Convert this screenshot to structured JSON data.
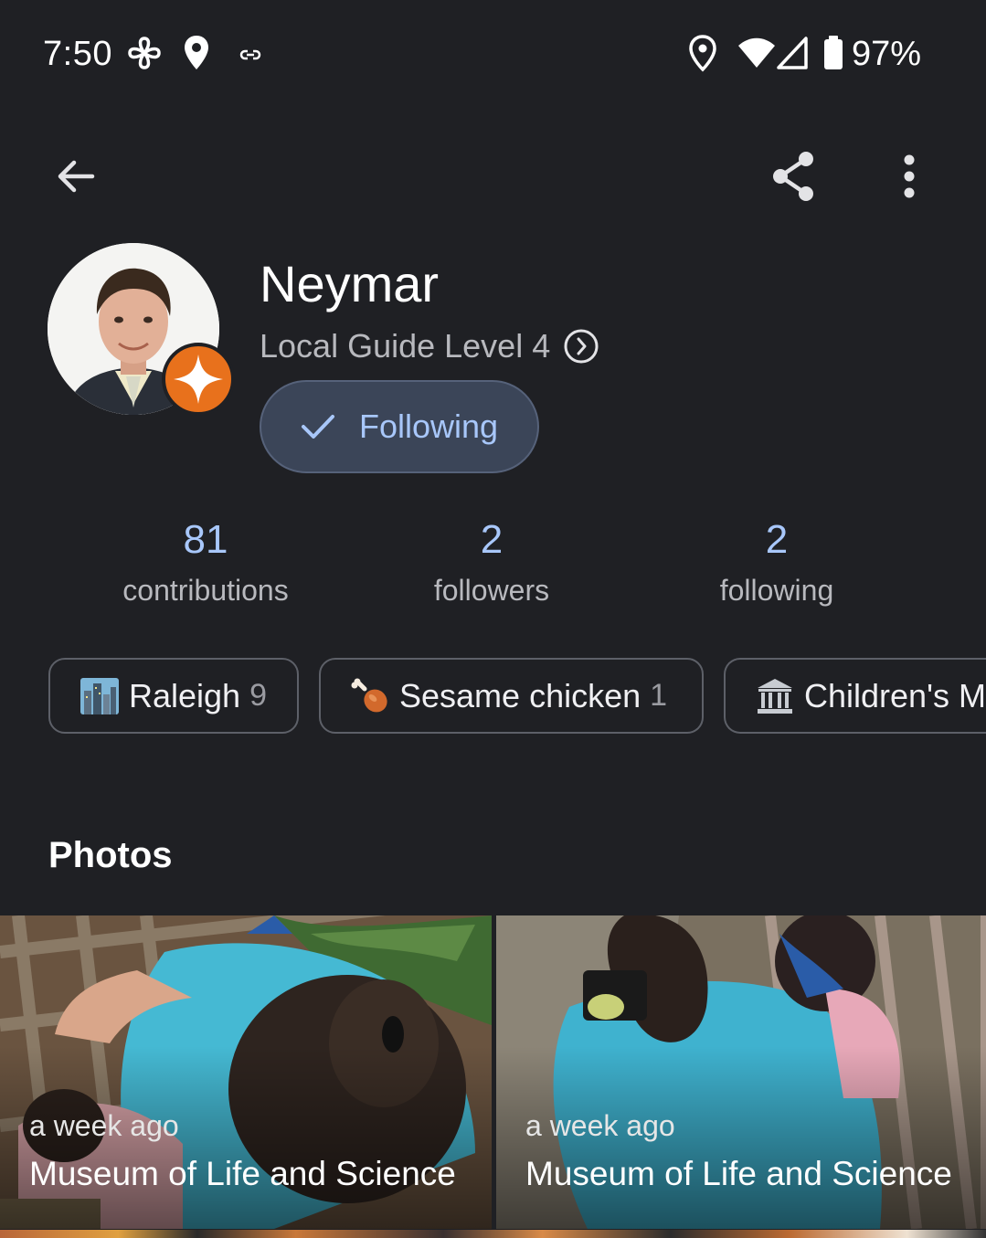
{
  "status_bar": {
    "time": "7:50",
    "battery": "97%"
  },
  "profile": {
    "name": "Neymar",
    "level": "Local Guide Level 4",
    "follow_button": "Following"
  },
  "stats": [
    {
      "value": "81",
      "label": "contributions"
    },
    {
      "value": "2",
      "label": "followers"
    },
    {
      "value": "2",
      "label": "following"
    }
  ],
  "chips": [
    {
      "label": "Raleigh",
      "count": "9",
      "icon": "cityscape-icon"
    },
    {
      "label": "Sesame chicken",
      "count": "1",
      "icon": "poultry-leg-icon"
    },
    {
      "label": "Children's M",
      "count": "",
      "icon": "museum-icon"
    }
  ],
  "photos_section": {
    "title": "Photos",
    "items": [
      {
        "time": "a week ago",
        "place": "Museum of Life and Science"
      },
      {
        "time": "a week ago",
        "place": "Museum of Life and Science"
      }
    ]
  },
  "colors": {
    "background": "#1f2024",
    "accent": "#a8c7fa",
    "following_button": "#3b4558",
    "badge": "#e8711c"
  }
}
